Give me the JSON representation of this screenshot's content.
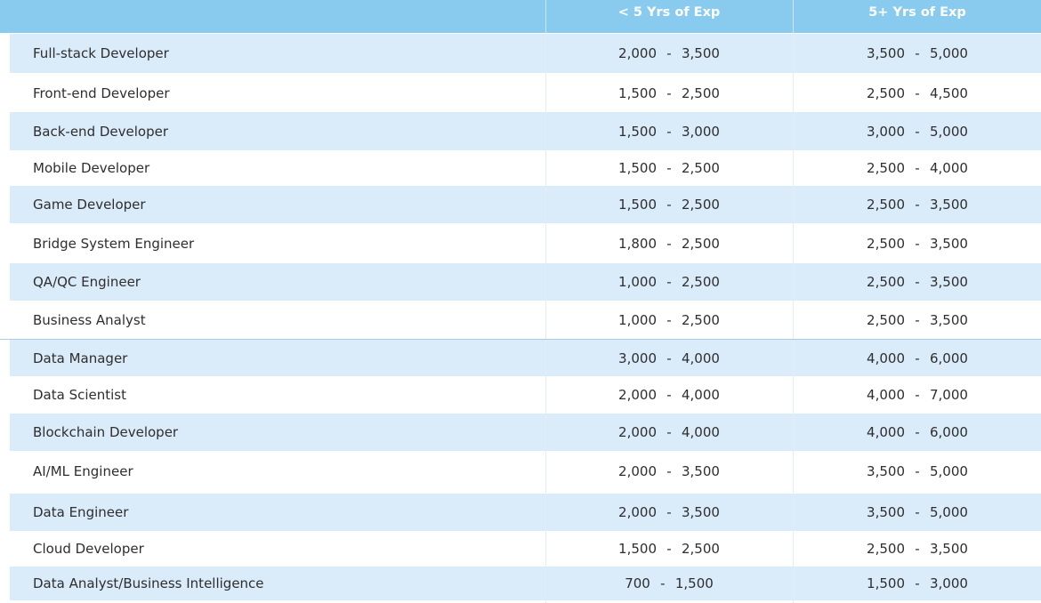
{
  "table": {
    "headers": [
      "",
      "< 5 Yrs of Exp",
      "5+ Yrs of Exp"
    ],
    "rows": [
      {
        "role": "Full-stack Developer",
        "junior": [
          "2,000",
          "-",
          "3,500"
        ],
        "senior": [
          "3,500",
          "-",
          "5,000"
        ]
      },
      {
        "role": "Front-end Developer",
        "junior": [
          "1,500",
          "-",
          "2,500"
        ],
        "senior": [
          "2,500",
          "-",
          "4,500"
        ]
      },
      {
        "role": "Back-end Developer",
        "junior": [
          "1,500",
          "-",
          "3,000"
        ],
        "senior": [
          "3,000",
          "-",
          "5,000"
        ]
      },
      {
        "role": "Mobile Developer",
        "junior": [
          "1,500",
          "-",
          "2,500"
        ],
        "senior": [
          "2,500",
          "-",
          "4,000"
        ]
      },
      {
        "role": "Game Developer",
        "junior": [
          "1,500",
          "-",
          "2,500"
        ],
        "senior": [
          "2,500",
          "-",
          "3,500"
        ]
      },
      {
        "role": "Bridge System Engineer",
        "junior": [
          "1,800",
          "-",
          "2,500"
        ],
        "senior": [
          "2,500",
          "-",
          "3,500"
        ]
      },
      {
        "role": "QA/QC Engineer",
        "junior": [
          "1,000",
          "-",
          "2,500"
        ],
        "senior": [
          "2,500",
          "-",
          "3,500"
        ]
      },
      {
        "role": "Business Analyst",
        "junior": [
          "1,000",
          "-",
          "2,500"
        ],
        "senior": [
          "2,500",
          "-",
          "3,500"
        ]
      },
      {
        "role": "Data Manager",
        "junior": [
          "3,000",
          "-",
          "4,000"
        ],
        "senior": [
          "4,000",
          "-",
          "6,000"
        ]
      },
      {
        "role": "Data Scientist",
        "junior": [
          "2,000",
          "-",
          "4,000"
        ],
        "senior": [
          "4,000",
          "-",
          "7,000"
        ]
      },
      {
        "role": "Blockchain Developer",
        "junior": [
          "2,000",
          "-",
          "4,000"
        ],
        "senior": [
          "4,000",
          "-",
          "6,000"
        ]
      },
      {
        "role": "AI/ML Engineer",
        "junior": [
          "2,000",
          "-",
          "3,500"
        ],
        "senior": [
          "3,500",
          "-",
          "5,000"
        ]
      },
      {
        "role": "Data Engineer",
        "junior": [
          "2,000",
          "-",
          "3,500"
        ],
        "senior": [
          "3,500",
          "-",
          "5,000"
        ]
      },
      {
        "role": "Cloud Developer",
        "junior": [
          "1,500",
          "-",
          "2,500"
        ],
        "senior": [
          "2,500",
          "-",
          "3,500"
        ]
      },
      {
        "role": "Data Analyst/Business Intelligence",
        "junior": [
          "700",
          "-",
          "1,500"
        ],
        "senior": [
          "1,500",
          "-",
          "3,000"
        ]
      }
    ]
  },
  "colors": {
    "header_bg": "#89cbef",
    "row_shade": "#daebf9",
    "header_text": "#ffffff"
  }
}
